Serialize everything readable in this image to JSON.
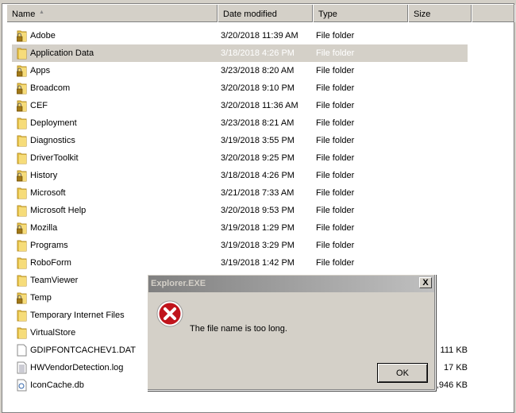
{
  "columns": [
    "Name",
    "Date modified",
    "Type",
    "Size"
  ],
  "sort_icon": "sort-ascending-icon",
  "selected": "Application Data",
  "files": [
    {
      "name": "Adobe",
      "date": "3/20/2018 11:39 AM",
      "type": "File folder",
      "size": "",
      "icon": "folder-locked"
    },
    {
      "name": "Application Data",
      "date": "3/18/2018 4:26 PM",
      "type": "File folder",
      "size": "",
      "icon": "folder"
    },
    {
      "name": "Apps",
      "date": "3/23/2018 8:20 AM",
      "type": "File folder",
      "size": "",
      "icon": "folder-locked"
    },
    {
      "name": "Broadcom",
      "date": "3/20/2018 9:10 PM",
      "type": "File folder",
      "size": "",
      "icon": "folder-locked"
    },
    {
      "name": "CEF",
      "date": "3/20/2018 11:36 AM",
      "type": "File folder",
      "size": "",
      "icon": "folder-locked"
    },
    {
      "name": "Deployment",
      "date": "3/23/2018 8:21 AM",
      "type": "File folder",
      "size": "",
      "icon": "folder"
    },
    {
      "name": "Diagnostics",
      "date": "3/19/2018 3:55 PM",
      "type": "File folder",
      "size": "",
      "icon": "folder"
    },
    {
      "name": "DriverToolkit",
      "date": "3/20/2018 9:25 PM",
      "type": "File folder",
      "size": "",
      "icon": "folder"
    },
    {
      "name": "History",
      "date": "3/18/2018 4:26 PM",
      "type": "File folder",
      "size": "",
      "icon": "folder-locked"
    },
    {
      "name": "Microsoft",
      "date": "3/21/2018 7:33 AM",
      "type": "File folder",
      "size": "",
      "icon": "folder"
    },
    {
      "name": "Microsoft Help",
      "date": "3/20/2018 9:53 PM",
      "type": "File folder",
      "size": "",
      "icon": "folder"
    },
    {
      "name": "Mozilla",
      "date": "3/19/2018 1:29 PM",
      "type": "File folder",
      "size": "",
      "icon": "folder-locked"
    },
    {
      "name": "Programs",
      "date": "3/19/2018 3:29 PM",
      "type": "File folder",
      "size": "",
      "icon": "folder"
    },
    {
      "name": "RoboForm",
      "date": "3/19/2018 1:42 PM",
      "type": "File folder",
      "size": "",
      "icon": "folder"
    },
    {
      "name": "TeamViewer",
      "date": "",
      "type": "",
      "size": "",
      "icon": "folder"
    },
    {
      "name": "Temp",
      "date": "",
      "type": "",
      "size": "",
      "icon": "folder-locked"
    },
    {
      "name": "Temporary Internet Files",
      "date": "",
      "type": "",
      "size": "",
      "icon": "folder"
    },
    {
      "name": "VirtualStore",
      "date": "",
      "type": "",
      "size": "",
      "icon": "folder"
    },
    {
      "name": "GDIPFONTCACHEV1.DAT",
      "date": "",
      "type": "",
      "size": "111 KB",
      "icon": "file"
    },
    {
      "name": "HWVendorDetection.log",
      "date": "",
      "type": "",
      "size": "17 KB",
      "icon": "text-file"
    },
    {
      "name": "IconCache.db",
      "date": "",
      "type": "",
      "size": ",946 KB",
      "icon": "db-file"
    }
  ],
  "dialog": {
    "title": "Explorer.EXE",
    "close": "X",
    "message": "The file name is too long.",
    "ok": "OK",
    "icon": "error-icon",
    "colors": {
      "error": "#c0141c"
    }
  }
}
